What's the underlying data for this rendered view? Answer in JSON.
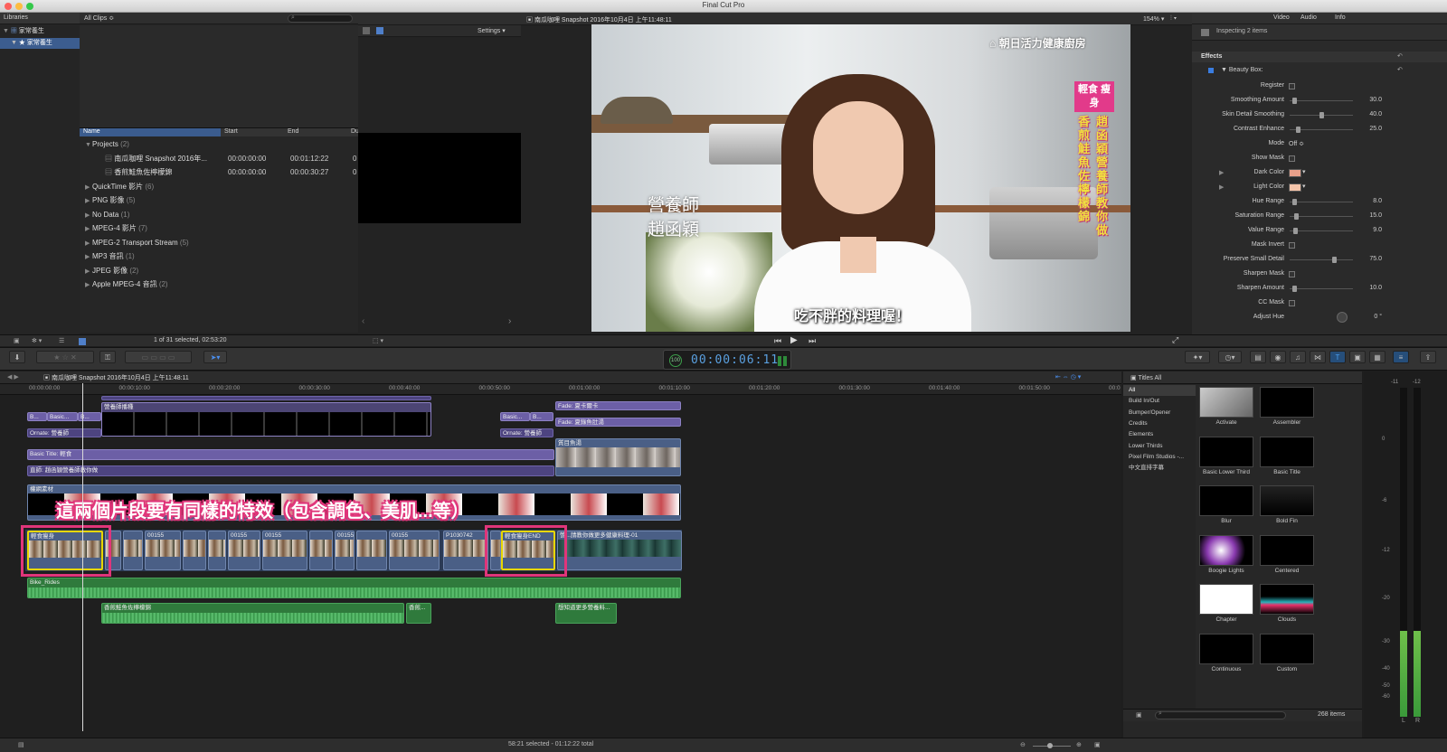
{
  "window": {
    "title": "Final Cut Pro"
  },
  "browser": {
    "libraries_label": "Libraries",
    "all_clips_label": "All Clips ≎",
    "library_name": "家常養生",
    "event_name": "家常養生",
    "columns": {
      "name": "Name",
      "start": "Start",
      "end": "End",
      "duration": "Du"
    },
    "rows": [
      {
        "name": "Projects",
        "count": "(2)",
        "level": 0,
        "expanded": true
      },
      {
        "name": "南瓜咖哩 Snapshot 2016年...",
        "start": "00:00:00:00",
        "end": "00:01:12:22",
        "du": "0",
        "level": 1
      },
      {
        "name": "香煎鮭魚佐檸檬錦",
        "start": "00:00:00:00",
        "end": "00:00:30:27",
        "du": "0",
        "level": 1
      },
      {
        "name": "QuickTime 影片",
        "count": "(6)",
        "level": 0
      },
      {
        "name": "PNG 影像",
        "count": "(5)",
        "level": 0
      },
      {
        "name": "No Data",
        "count": "(1)",
        "level": 0
      },
      {
        "name": "MPEG-4 影片",
        "count": "(7)",
        "level": 0
      },
      {
        "name": "MPEG-2 Transport Stream",
        "count": "(5)",
        "level": 0
      },
      {
        "name": "MP3 音訊",
        "count": "(1)",
        "level": 0
      },
      {
        "name": "JPEG 影像",
        "count": "(2)",
        "level": 0
      },
      {
        "name": "Apple MPEG-4 音訊",
        "count": "(2)",
        "level": 0
      }
    ],
    "status": "1 of 31 selected, 02:53:20"
  },
  "event_viewer": {
    "settings_label": "Settings"
  },
  "viewer": {
    "title": "南瓜咖哩 Snapshot 2016年10月4日 上午11:48:11",
    "zoom": "154%",
    "overlay_brand": "朝日活力健康廚房",
    "overlay_badge": "輕食 瘦身",
    "overlay_vertical_1": "趙函穎營養師教你做",
    "overlay_vertical_2": "香煎鮭魚佐檸檬錦",
    "overlay_name_1": "營養師",
    "overlay_name_2": "趙函穎",
    "subtitle": "吃不胖的料理喔！"
  },
  "inspector": {
    "tabs": [
      "Video",
      "Audio",
      "Info"
    ],
    "inspecting": "Inspecting 2 items",
    "effects_label": "Effects",
    "effect_name": "Beauty Box:",
    "params": [
      {
        "label": "Register",
        "type": "check"
      },
      {
        "label": "Smoothing Amount",
        "type": "slider",
        "value": "30.0",
        "level": 0.05
      },
      {
        "label": "Skin Detail Smoothing",
        "type": "slider",
        "value": "40.0",
        "level": 0.5
      },
      {
        "label": "Contrast Enhance",
        "type": "slider",
        "value": "25.0",
        "level": 0.1
      },
      {
        "label": "Mode",
        "type": "popup",
        "value": "Off ≎"
      },
      {
        "label": "Show Mask",
        "type": "check"
      },
      {
        "label": "Dark Color",
        "type": "color",
        "value": "#e9a08a"
      },
      {
        "label": "Light Color",
        "type": "color",
        "value": "#f6c5aa"
      },
      {
        "label": "Hue Range",
        "type": "slider",
        "value": "8.0",
        "level": 0.05
      },
      {
        "label": "Saturation Range",
        "type": "slider",
        "value": "15.0",
        "level": 0.08
      },
      {
        "label": "Value Range",
        "type": "slider",
        "value": "9.0",
        "level": 0.06
      },
      {
        "label": "Mask Invert",
        "type": "check"
      },
      {
        "label": "Preserve Small Detail",
        "type": "slider",
        "value": "75.0",
        "level": 0.72
      },
      {
        "label": "Sharpen Mask",
        "type": "check"
      },
      {
        "label": "Sharpen Amount",
        "type": "slider",
        "value": "10.0",
        "level": 0.05
      },
      {
        "label": "CC Mask",
        "type": "check"
      },
      {
        "label": "Adjust Hue",
        "type": "dial",
        "value": "0 °"
      }
    ]
  },
  "timecode": {
    "display": "6:11",
    "main": "100"
  },
  "timeline": {
    "title": "南瓜咖哩 Snapshot 2016年10月4日 上午11:48:11",
    "ruler": [
      "00:00:00:00",
      "00:00:10:00",
      "00:00:20:00",
      "00:00:30:00",
      "00:00:40:00",
      "00:00:50:00",
      "00:01:00:00",
      "00:01:10:00",
      "00:01:20:00",
      "00:01:30:00",
      "00:01:40:00",
      "00:01:50:00",
      "00:0"
    ],
    "clips": {
      "c_basic1": "B...",
      "c_basic2": "Basic...",
      "c_basic3": "B...",
      "c_yy": "營養師播種",
      "c_basic4": "Basic...",
      "c_basic5": "B...",
      "c_fade1": "Fade: 夏卡爾卡",
      "c_fade2": "Fade: 夏錄魚肚湯",
      "c_ornate1": "Ornate: 營養師",
      "c_ornate2": "Ornate: 營養師",
      "c_mgd": "質目魚湯",
      "c_basictitle": "Basic Title: 輕食",
      "c_zhao": "直師: 趙函穎營養師教你做",
      "c_yj": "權網素材",
      "main1": "輕食瘦身",
      "main2": "00155",
      "main3": "00155",
      "main4": "00155",
      "main5": "00155",
      "main6": "00155",
      "main7": "P1030742",
      "main8": "輕食瘦身END",
      "main9": "營...請教你做更多健康料理-01",
      "music": "Bike_Rides",
      "vo1": "香煎鮭魚佐檸檬錦",
      "vo2": "香煎...",
      "vo3": "想知道更多營養料..."
    },
    "annotation": "這兩個片段要有同樣的特效（包含調色、美肌...等）",
    "status": "58:21 selected - 01:12:22 total"
  },
  "titles_browser": {
    "header": "Titles  All",
    "categories": [
      "All",
      "Build In/Out",
      "Bumper/Opener",
      "Credits",
      "Elements",
      "Lower Thirds",
      "Pixel Film Studios -...",
      "中文直排字幕"
    ],
    "items": [
      "Activate",
      "Assembler",
      "Basic Lower Third",
      "Basic Title",
      "Blur",
      "Bold Fin",
      "Boogie Lights",
      "Centered",
      "Chapter",
      "Clouds",
      "Continuous",
      "Custom"
    ],
    "count": "268 items"
  },
  "meters": {
    "ticks": [
      "-11",
      "-12",
      "0",
      "-6",
      "-12",
      "-20",
      "-30",
      "-40",
      "-50",
      "-60"
    ],
    "channels": [
      "L",
      "R"
    ],
    "level": 0.26
  }
}
